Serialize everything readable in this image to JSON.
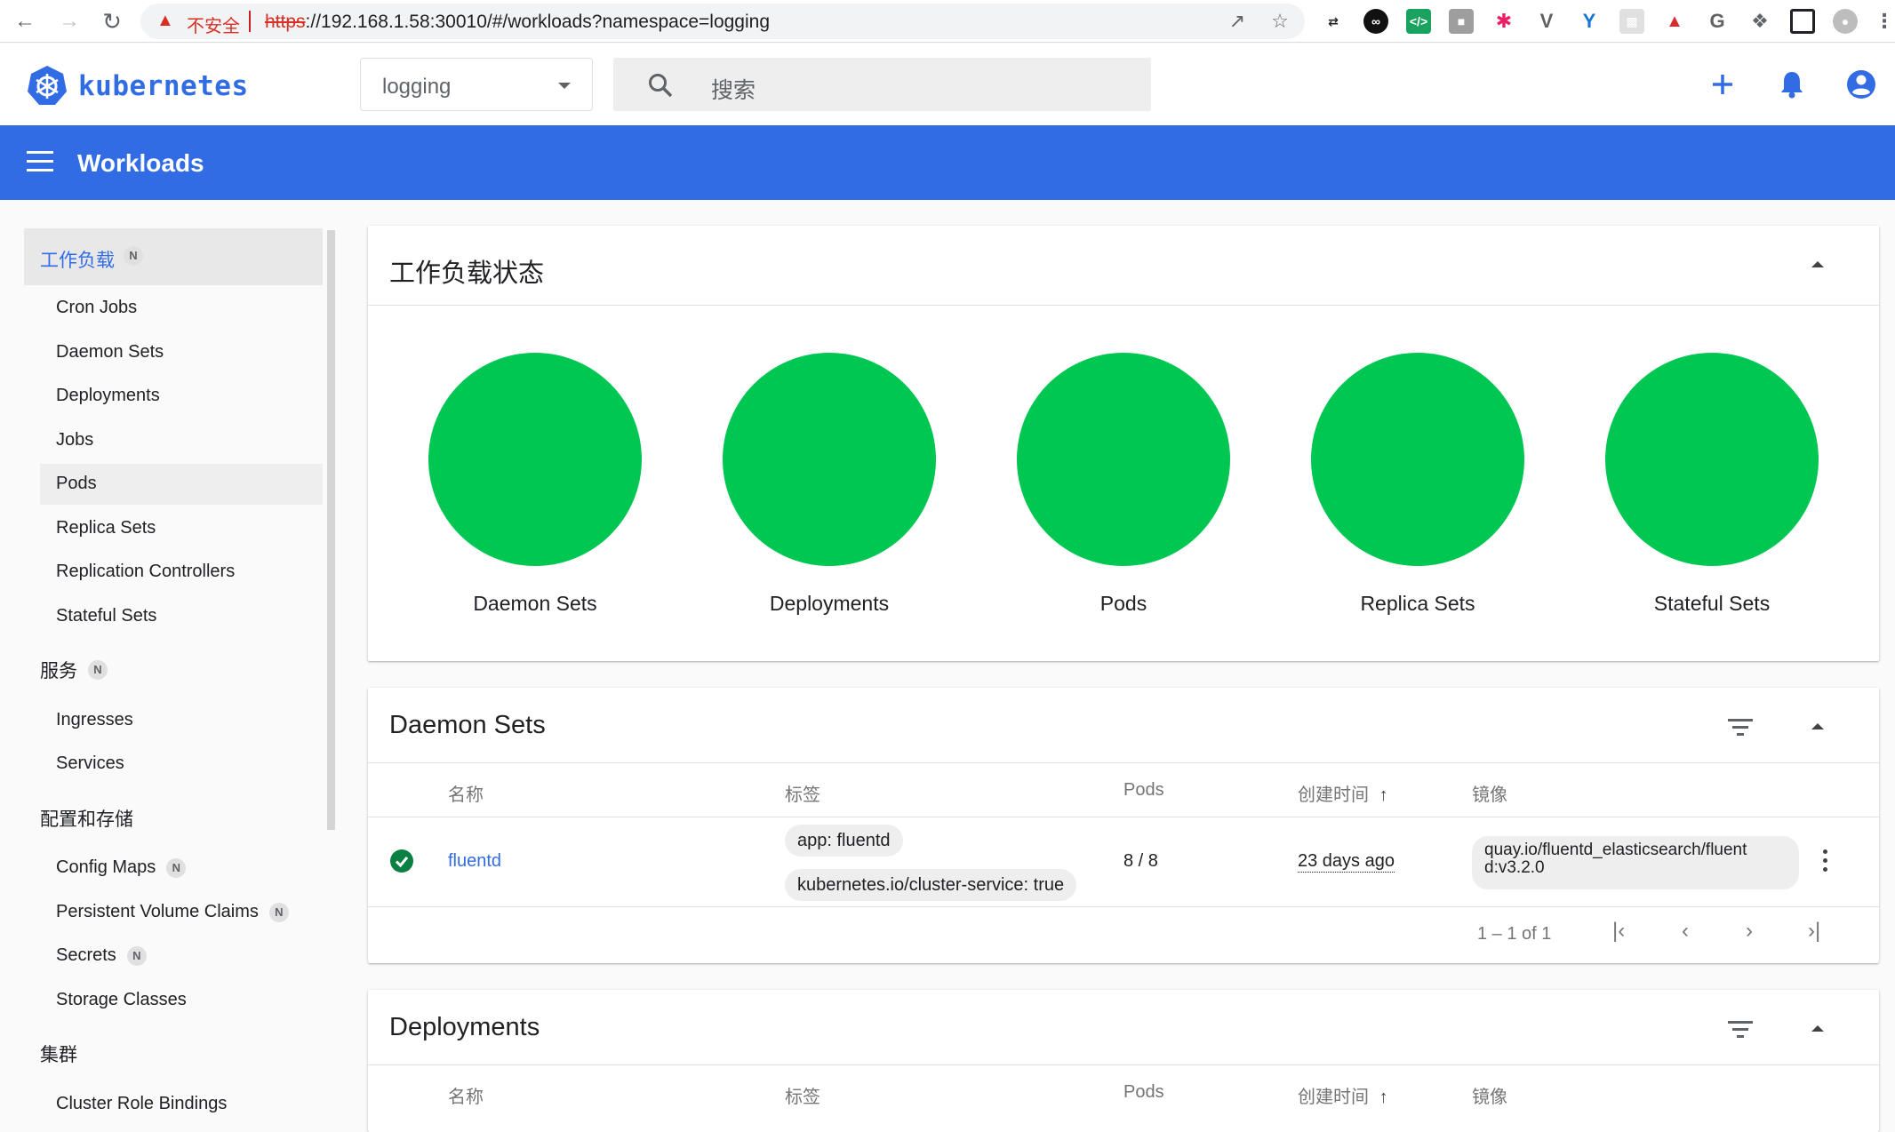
{
  "browser": {
    "security_warning": "不安全",
    "url_scheme": "https",
    "url_rest": "://192.168.1.58:30010/#/workloads?namespace=logging"
  },
  "header": {
    "brand": "kubernetes",
    "namespace": "logging",
    "search_placeholder": "搜索"
  },
  "toolbar": {
    "title": "Workloads"
  },
  "sidebar": {
    "group_workloads": {
      "label": "工作负载",
      "badge": "N"
    },
    "workload_items": [
      "Cron Jobs",
      "Daemon Sets",
      "Deployments",
      "Jobs",
      "Pods",
      "Replica Sets",
      "Replication Controllers",
      "Stateful Sets"
    ],
    "group_services": {
      "label": "服务",
      "badge": "N"
    },
    "service_items": [
      "Ingresses",
      "Services"
    ],
    "group_config": {
      "label": "配置和存储"
    },
    "config_items": [
      {
        "label": "Config Maps",
        "badge": "N"
      },
      {
        "label": "Persistent Volume Claims",
        "badge": "N"
      },
      {
        "label": "Secrets",
        "badge": "N"
      },
      {
        "label": "Storage Classes",
        "badge": ""
      }
    ],
    "group_cluster": {
      "label": "集群"
    },
    "cluster_items": [
      "Cluster Role Bindings"
    ]
  },
  "status_card": {
    "title": "工作负载状态",
    "items": [
      "Daemon Sets",
      "Deployments",
      "Pods",
      "Replica Sets",
      "Stateful Sets"
    ],
    "color": "#00c752"
  },
  "daemon_sets": {
    "title": "Daemon Sets",
    "columns": {
      "name": "名称",
      "labels": "标签",
      "pods": "Pods",
      "created": "创建时间",
      "images": "镜像"
    },
    "rows": [
      {
        "name": "fluentd",
        "labels": [
          "app: fluentd",
          "kubernetes.io/cluster-service: true"
        ],
        "pods": "8 / 8",
        "created": "23 days ago",
        "image_line1": "quay.io/fluentd_elasticsearch/fluent",
        "image_line2": "d:v3.2.0"
      }
    ],
    "pagination": "1 – 1 of 1"
  },
  "deployments": {
    "title": "Deployments",
    "columns": {
      "name": "名称",
      "labels": "标签",
      "pods": "Pods",
      "created": "创建时间",
      "images": "镜像"
    }
  },
  "colors": {
    "primary": "#326ce5",
    "success": "#00c752",
    "link": "#326ce5"
  }
}
